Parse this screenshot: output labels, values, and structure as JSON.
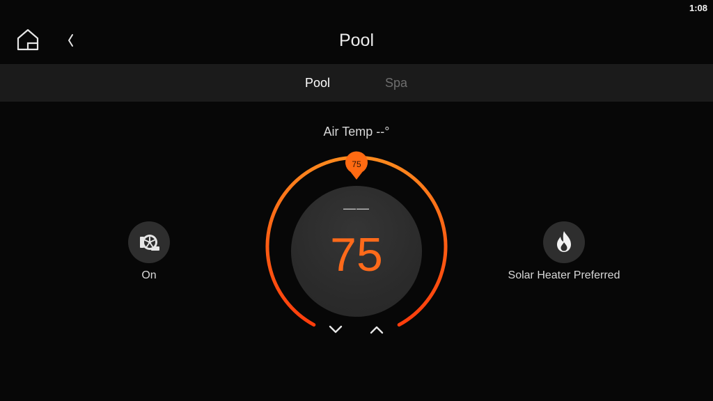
{
  "status_bar": {
    "time": "1:08"
  },
  "header": {
    "title": "Pool"
  },
  "tabs": [
    {
      "label": "Pool",
      "active": true
    },
    {
      "label": "Spa",
      "active": false
    }
  ],
  "air_temp": "Air Temp --°",
  "thermostat": {
    "current_temp": "——",
    "setpoint": "75",
    "marker_label": "75",
    "accent_color": "#ff5a14"
  },
  "pump": {
    "label": "On",
    "icon": "pump-icon"
  },
  "heater": {
    "label": "Solar Heater Preferred",
    "icon": "flame-icon"
  }
}
